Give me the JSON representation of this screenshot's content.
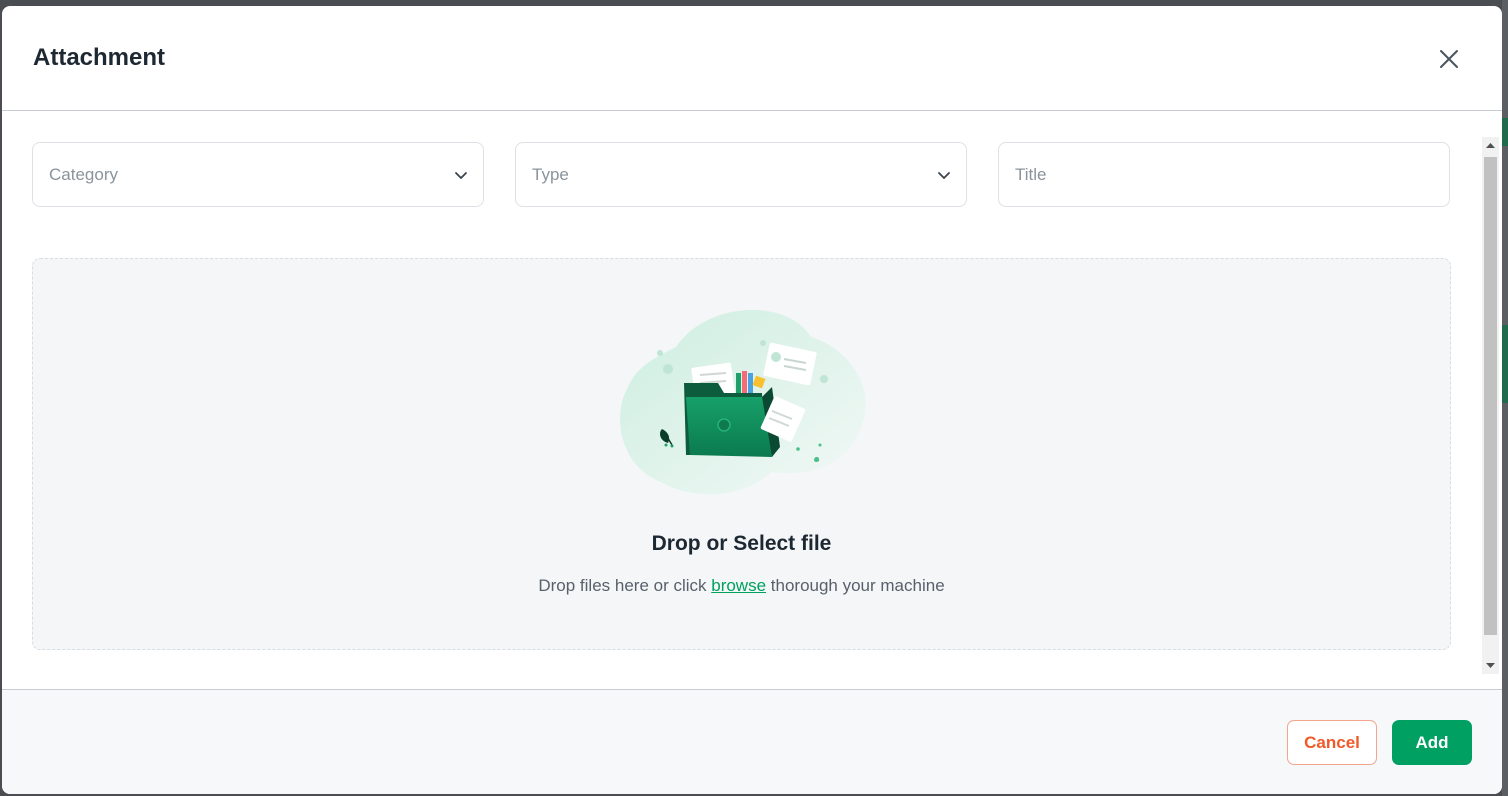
{
  "modal": {
    "title": "Attachment",
    "close_icon": "close-icon"
  },
  "form": {
    "category": {
      "placeholder": "Category",
      "icon": "chevron-down-icon"
    },
    "type": {
      "placeholder": "Type",
      "icon": "chevron-down-icon"
    },
    "title": {
      "placeholder": "Title"
    }
  },
  "dropzone": {
    "illustration_icon": "folder-upload-illustration",
    "title": "Drop or Select file",
    "subtitle_prefix": "Drop files here or click ",
    "browse_link": "browse",
    "subtitle_suffix": " thorough your machine"
  },
  "footer": {
    "cancel_label": "Cancel",
    "add_label": "Add"
  },
  "colors": {
    "primary": "#00a063",
    "danger": "#f05a28",
    "link": "#00a15f",
    "title_text": "#1e2833"
  }
}
